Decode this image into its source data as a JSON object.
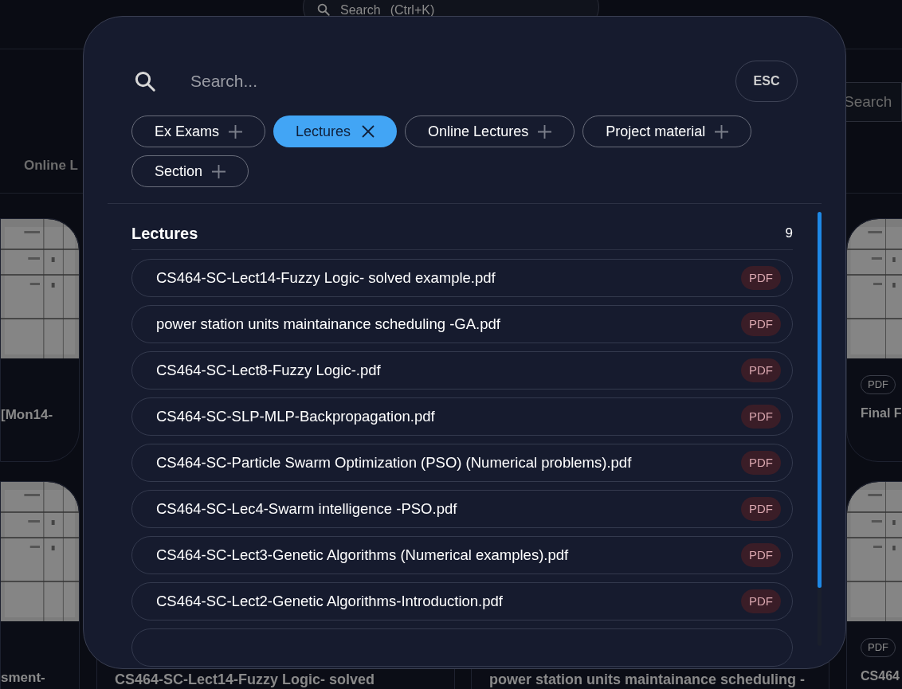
{
  "background_page": {
    "header_search": {
      "placeholder": "Search",
      "shortcut": "(Ctrl+K)"
    },
    "tab": "Online L",
    "search_field": {
      "placeholder": "Search"
    },
    "left_cards": [
      {
        "title": "[Mon14-"
      },
      {
        "title": "sment-"
      }
    ],
    "right_cards": [
      {
        "badge": "PDF",
        "title": "Final F"
      },
      {
        "badge": "PDF",
        "title": "CS464"
      }
    ],
    "bottom_cards": [
      {
        "title": "CS464-SC-Lect14-Fuzzy Logic- solved"
      },
      {
        "title": "power station units maintainance scheduling -"
      }
    ]
  },
  "search_dialog": {
    "search": {
      "placeholder": "Search..."
    },
    "close_button": "ESC",
    "filters": [
      {
        "label": "Ex Exams",
        "selected": false
      },
      {
        "label": "Lectures",
        "selected": true
      },
      {
        "label": "Online Lectures",
        "selected": false
      },
      {
        "label": "Project material",
        "selected": false
      },
      {
        "label": "Section",
        "selected": false
      }
    ],
    "section": {
      "title": "Lectures",
      "count": "9"
    },
    "results": [
      {
        "name": "CS464-SC-Lect14-Fuzzy Logic- solved example.pdf",
        "badge": "PDF"
      },
      {
        "name": "power station units maintainance scheduling -GA.pdf",
        "badge": "PDF"
      },
      {
        "name": "CS464-SC-Lect8-Fuzzy Logic-.pdf",
        "badge": "PDF"
      },
      {
        "name": "CS464-SC-SLP-MLP-Backpropagation.pdf",
        "badge": "PDF"
      },
      {
        "name": "CS464-SC-Particle Swarm Optimization (PSO) (Numerical problems).pdf",
        "badge": "PDF"
      },
      {
        "name": "CS464-SC-Lec4-Swarm intelligence -PSO.pdf",
        "badge": "PDF"
      },
      {
        "name": "CS464-SC-Lect3-Genetic Algorithms (Numerical examples).pdf",
        "badge": "PDF"
      },
      {
        "name": "CS464-SC-Lect2-Genetic Algorithms-Introduction.pdf",
        "badge": "PDF"
      }
    ]
  }
}
